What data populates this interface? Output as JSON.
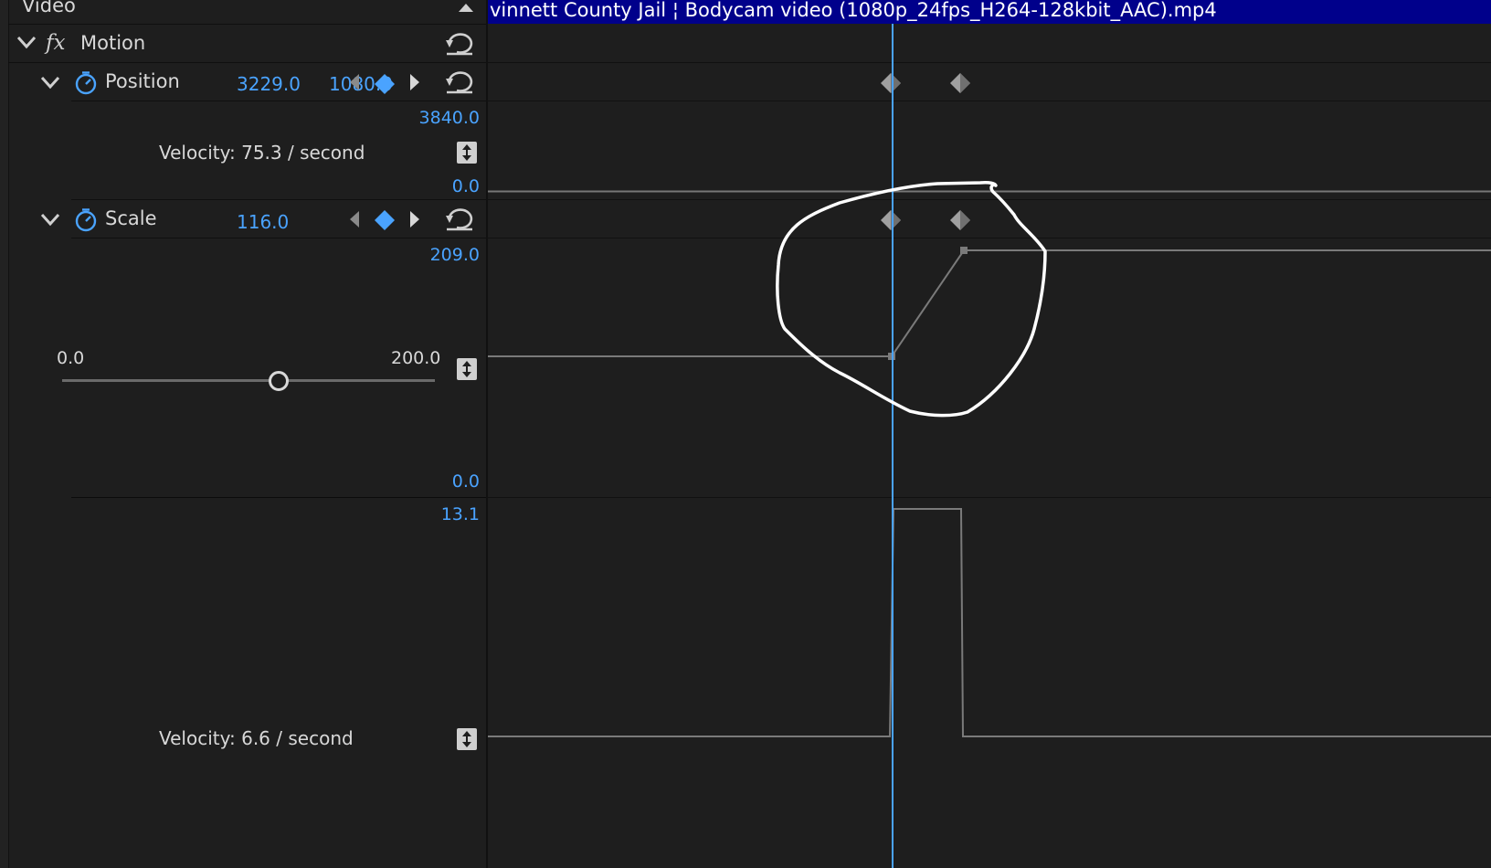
{
  "panel": {
    "section_label": "Video"
  },
  "clip": {
    "name": "vinnett County Jail ¦ Bodycam video (1080p_24fps_H264-128kbit_AAC).mp4"
  },
  "motion": {
    "fx_label": "fx",
    "label": "Motion"
  },
  "position": {
    "label": "Position",
    "x_value": "3229.0",
    "y_value": "1080.0",
    "graph_max": "3840.0",
    "graph_min": "0.0",
    "velocity": "Velocity: 75.3 / second"
  },
  "scale": {
    "label": "Scale",
    "value": "116.0",
    "graph_max": "209.0",
    "graph_min": "0.0",
    "slider_min": "0.0",
    "slider_max": "200.0",
    "slider_value": 116.0,
    "velocity_max": "13.1",
    "velocity": "Velocity: 6.6 / second"
  },
  "colors": {
    "accent": "#4aa3ff",
    "clip_bar": "#00008b",
    "background": "#1e1e1e",
    "keyframe": "#9a9a9a",
    "annotation": "#ffffff"
  }
}
